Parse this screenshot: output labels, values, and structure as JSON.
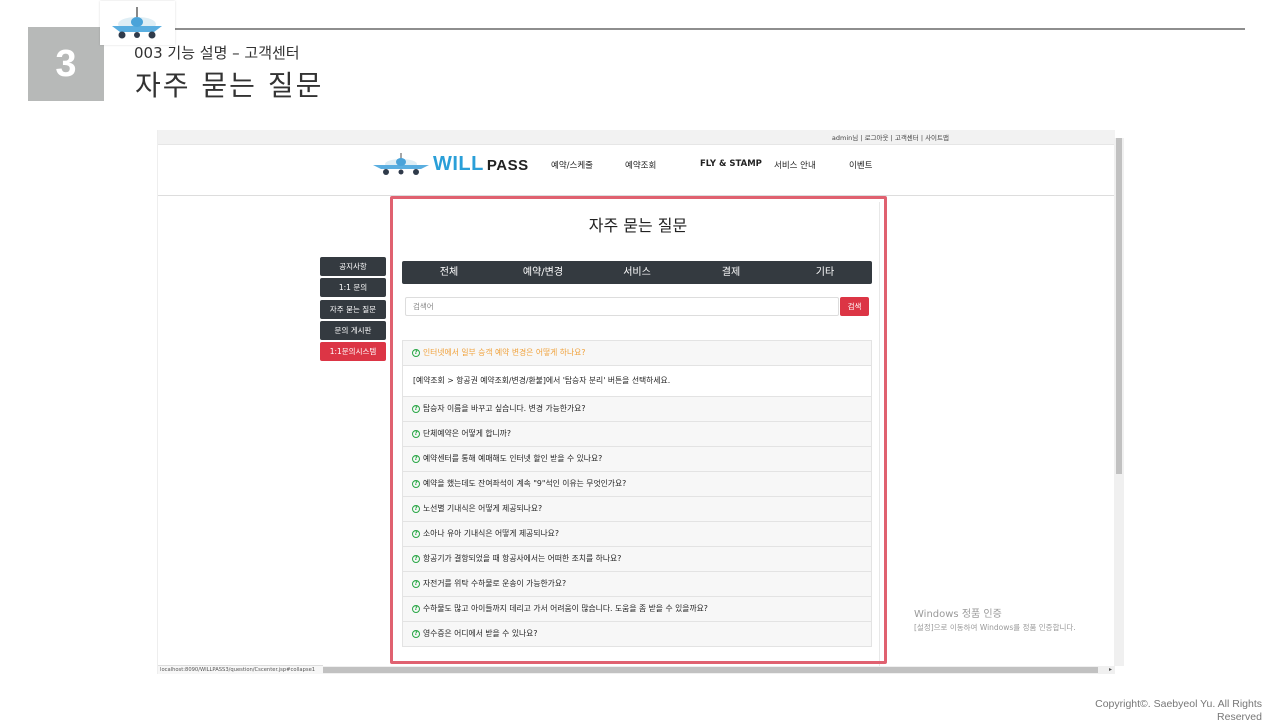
{
  "slide": {
    "number": "3",
    "subtitle": "003 기능 설명 – 고객센터",
    "title": "자주 묻는 질문",
    "copyright": "Copyright©. Saebyeol Yu. All Rights Reserved"
  },
  "site": {
    "top_links": "admin님 | 로그아웃 | 고객센터 | 사이트맵",
    "brand": {
      "name": "WILL",
      "suffix": "PASS"
    },
    "nav": [
      "예약/스케줄",
      "예약조회",
      "FLY & STAMP",
      "서비스 안내",
      "이벤트"
    ],
    "side_menu": [
      "공지사항",
      "1:1 문의",
      "자주 묻는 질문",
      "문의 게시판",
      "1:1문의시스템"
    ],
    "page_title": "자주 묻는 질문",
    "tabs": [
      "전체",
      "예약/변경",
      "서비스",
      "결제",
      "기타"
    ],
    "search": {
      "placeholder": "검색어",
      "button": "검색"
    },
    "faqs": [
      {
        "q": "인터넷에서 일부 승객 예약 변경은 어떻게 하나요?",
        "open": true,
        "a": "[예약조회 > 항공권 예약조회/변경/환불]에서 '탑승자 분리' 버튼을 선택하세요."
      },
      {
        "q": "탑승자 이름을 바꾸고 싶습니다. 변경 가능한가요?"
      },
      {
        "q": "단체예약은 어떻게 합니까?"
      },
      {
        "q": "예약센터를 통해 예매해도 인터넷 할인 받을 수 있나요?"
      },
      {
        "q": "예약을 했는데도 잔여좌석이 계속 \"9\"석인 이유는 무엇인가요?"
      },
      {
        "q": "노선별 기내식은 어떻게 제공되나요?"
      },
      {
        "q": "소아나 유아 기내식은 어떻게 제공되나요?"
      },
      {
        "q": "항공기가 결항되었을 때 항공사에서는 어떠한 조치를 하나요?"
      },
      {
        "q": "자전거를 위탁 수하물로 운송이 가능한가요?"
      },
      {
        "q": "수하물도 많고 아이들까지 데리고 가서 어려움이 많습니다. 도움을 좀 받을 수 있을까요?"
      },
      {
        "q": "영수증은 어디에서 받을 수 있나요?"
      }
    ],
    "status_url": "localhost:8090/WILLPASS3/question/Cscenter.jsp#collapse1"
  },
  "watermark": {
    "line1": "Windows 정품 인증",
    "line2": "[설정]으로 이동하여 Windows를 정품 인증합니다."
  },
  "colors": {
    "dark": "#343a40",
    "accent": "#dc3545",
    "brand": "#2a9fd8",
    "highlight": "#e06170",
    "open_question": "#f0a13a"
  }
}
